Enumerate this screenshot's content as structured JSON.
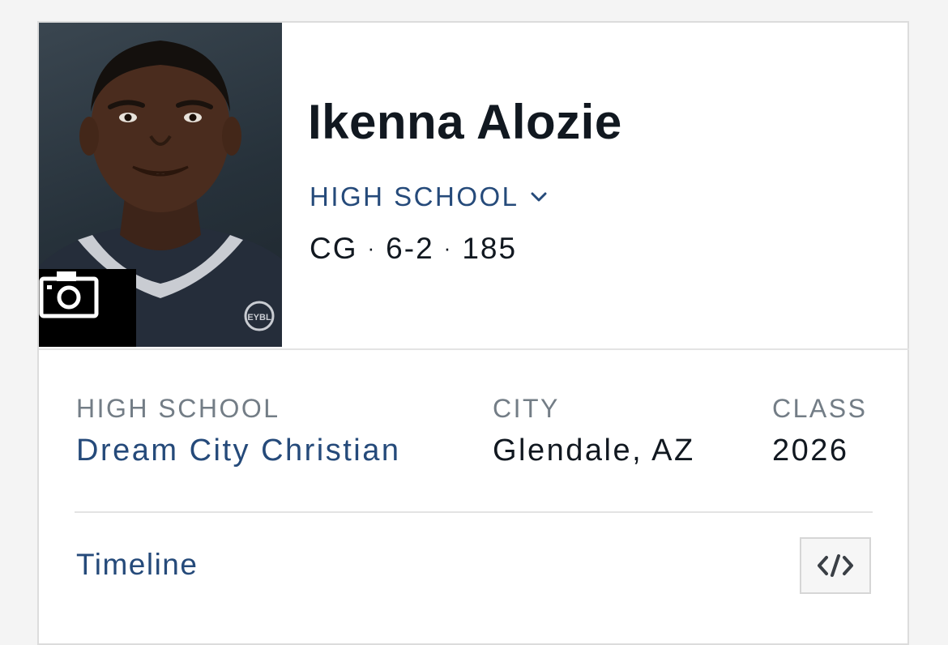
{
  "player": {
    "name": "Ikenna Alozie",
    "level": "HIGH SCHOOL",
    "position": "CG",
    "height": "6-2",
    "weight": "185",
    "separator": "·"
  },
  "photo": {
    "jersey_logo": "EYBL"
  },
  "info": {
    "high_school": {
      "label": "HIGH SCHOOL",
      "value": "Dream City Christian"
    },
    "city": {
      "label": "CITY",
      "value": "Glendale, AZ"
    },
    "class": {
      "label": "CLASS",
      "value": "2026"
    }
  },
  "footer": {
    "timeline_label": "Timeline"
  },
  "icons": {
    "camera": "camera-icon",
    "chevron": "chevron-down-icon",
    "embed": "code-embed-icon"
  },
  "colors": {
    "accent": "#254a7a",
    "text": "#111820",
    "muted": "#737d86",
    "background": "#f4f4f4"
  }
}
